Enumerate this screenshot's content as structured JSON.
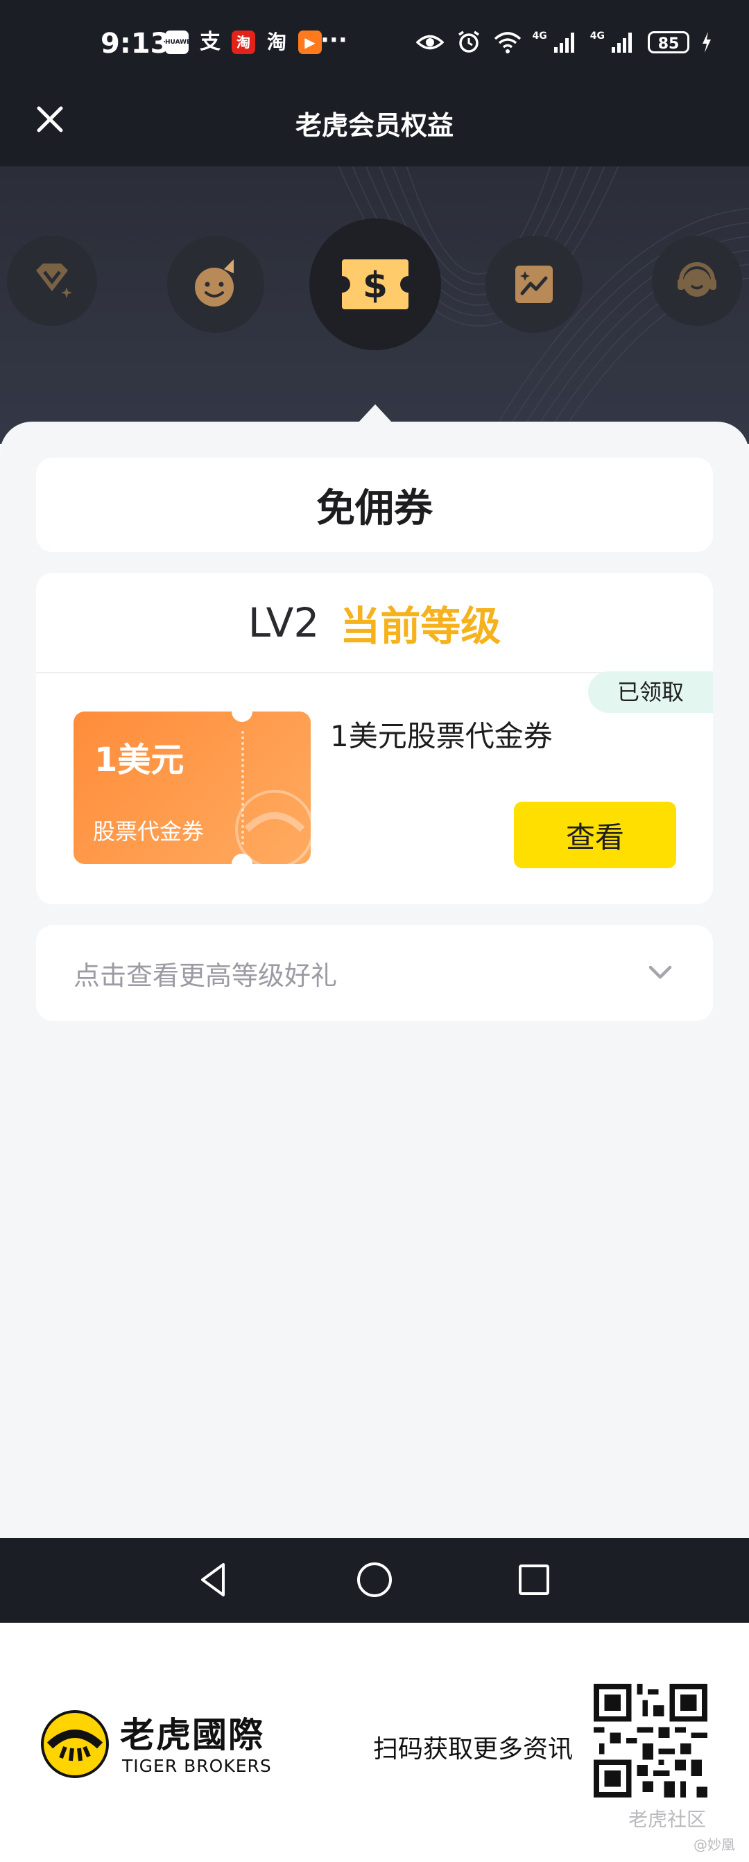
{
  "status_bar": {
    "time": "9:13",
    "app_icons": [
      "HUAWEI",
      "支",
      "淘",
      "淘",
      "▶"
    ],
    "overflow": "···",
    "signal_labels": [
      "4G",
      "4G"
    ],
    "battery": "85"
  },
  "header": {
    "title": "老虎会员权益",
    "close_icon": "close-icon"
  },
  "benefit_tabs": [
    {
      "icon": "diamond-icon",
      "active": false
    },
    {
      "icon": "smiley-party-icon",
      "active": false
    },
    {
      "icon": "dollar-ticket-icon",
      "active": true
    },
    {
      "icon": "chart-image-icon",
      "active": false
    },
    {
      "icon": "headset-icon",
      "active": false
    }
  ],
  "section_title": "免佣券",
  "level": {
    "name": "LV2",
    "current_label": "当前等级"
  },
  "coupon": {
    "amount": "1美元",
    "type": "股票代金券",
    "name": "1美元股票代金券",
    "status_badge": "已领取",
    "view_button": "查看"
  },
  "more": {
    "text": "点击查看更高等级好礼"
  },
  "footer": {
    "brand_cn": "老虎國際",
    "brand_en": "TIGER BROKERS",
    "scan_text": "扫码获取更多资讯",
    "watermark": "老虎社区",
    "watermark_sub": "@妙凰"
  },
  "colors": {
    "dark_bg": "#1c1e26",
    "accent_gold": "#f5b21c",
    "button_yellow": "#ffdf00",
    "coupon_orange": "#ff8c3a",
    "badge_bg": "#e3f6ef"
  }
}
